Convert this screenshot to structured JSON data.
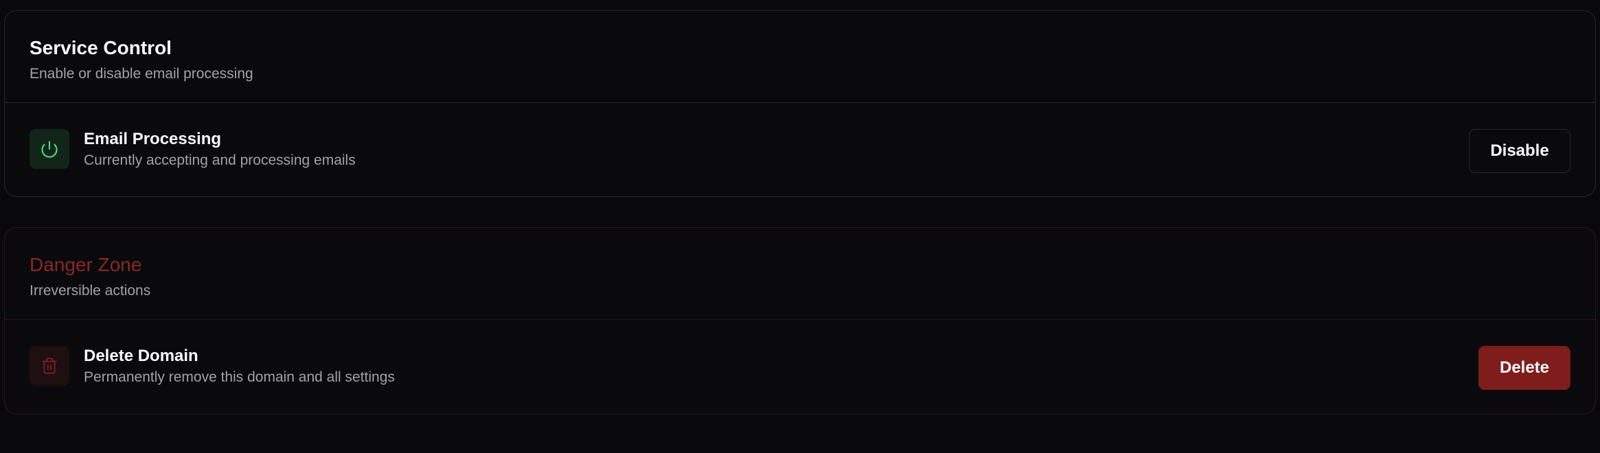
{
  "service_control": {
    "title": "Service Control",
    "description": "Enable or disable email processing",
    "row": {
      "icon": "power-icon",
      "title": "Email Processing",
      "description": "Currently accepting and processing emails",
      "button_label": "Disable"
    }
  },
  "danger_zone": {
    "title": "Danger Zone",
    "description": "Irreversible actions",
    "row": {
      "icon": "trash-icon",
      "title": "Delete Domain",
      "description": "Permanently remove this domain and all settings",
      "button_label": "Delete"
    }
  },
  "colors": {
    "background": "#09090b",
    "border": "#27272a",
    "success": "#4ade80",
    "danger": "#7f1d1d",
    "danger_text": "#8b2727"
  }
}
